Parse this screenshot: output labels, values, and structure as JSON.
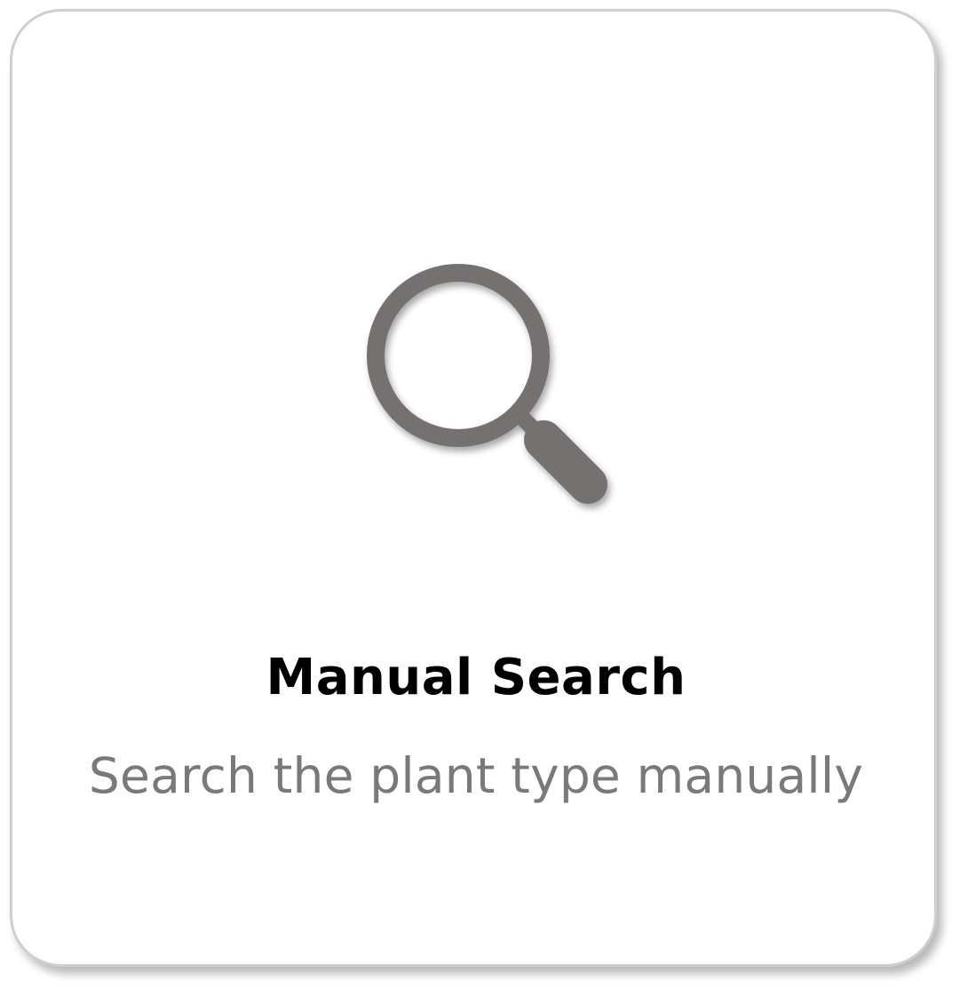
{
  "card": {
    "title": "Manual Search",
    "subtitle": "Search the plant type manually",
    "icon": "search-icon"
  },
  "colors": {
    "icon": "#757171",
    "title": "#000000",
    "subtitle": "#7a7878",
    "border": "#cfcfcf"
  }
}
